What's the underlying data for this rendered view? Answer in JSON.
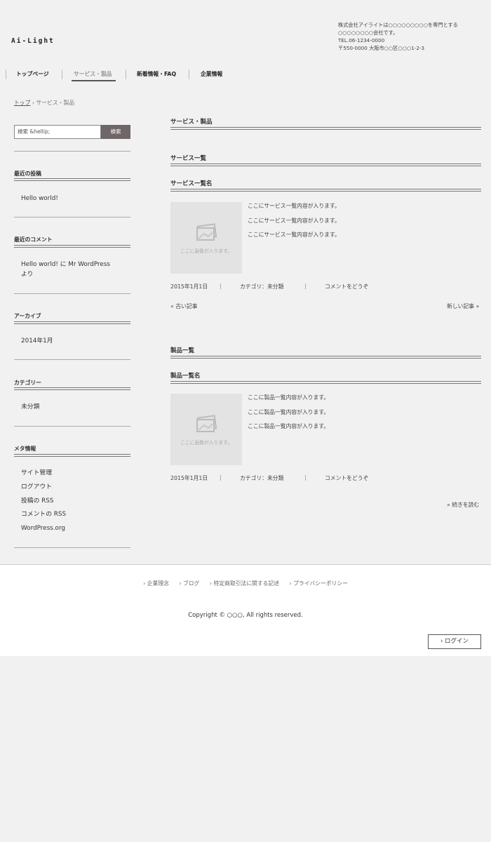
{
  "header": {
    "logo": "Ai-Light",
    "company_lines": [
      "株式会社アイライトは○○○○○○○○○を専門とする",
      "○○○○○○○○会社です。",
      "TEL.06-1234-0000",
      "〒550-0000 大阪市○○区○○○1-2-3"
    ]
  },
  "nav": {
    "items": [
      {
        "label": "トップページ"
      },
      {
        "label": "サービス・製品"
      },
      {
        "label": "新着情報・FAQ"
      },
      {
        "label": "企業情報"
      }
    ]
  },
  "breadcrumb": {
    "home": "トップ",
    "separator": " › ",
    "current": "サービス・製品"
  },
  "sidebar": {
    "search": {
      "placeholder": "検索 &hellip;",
      "button": "検索"
    },
    "recent_posts": {
      "title": "最近の投稿",
      "items": [
        "Hello world!"
      ]
    },
    "recent_comments": {
      "title": "最近のコメント",
      "line1": "Hello world! に Mr WordPress",
      "line2": "より"
    },
    "archives": {
      "title": "アーカイブ",
      "items": [
        "2014年1月"
      ]
    },
    "categories": {
      "title": "カテゴリー",
      "items": [
        "未分類"
      ]
    },
    "meta": {
      "title": "メタ情報",
      "items": [
        "サイト管理",
        "ログアウト",
        "投稿の RSS",
        "コメントの RSS",
        "WordPress.org"
      ]
    }
  },
  "main": {
    "page_title": "サービス・製品",
    "service_section": "サービス一覧",
    "service_post": {
      "title": "サービス一覧名",
      "thumb_text": "ここに画像が入ります。",
      "excerpt": [
        "ここにサービス一覧内容が入ります。",
        "ここにサービス一覧内容が入ります。",
        "ここにサービス一覧内容が入ります。"
      ],
      "date": "2015年1月1日",
      "category": "カテゴリ：未分類",
      "comment": "コメントをどうぞ"
    },
    "pager": {
      "older": "« 古い記事",
      "newer": "新しい記事 »"
    },
    "product_section": "製品一覧",
    "product_post": {
      "title": "製品一覧名",
      "thumb_text": "ここに画像が入ります。",
      "excerpt": [
        "ここに製品一覧内容が入ります。",
        "ここに製品一覧内容が入ります。",
        "ここに製品一覧内容が入ります。"
      ],
      "date": "2015年1月1日",
      "category": "カテゴリ：未分類",
      "comment": "コメントをどうぞ"
    },
    "read_more": "» 続きを読む",
    "meta_separator": "|"
  },
  "footer": {
    "links": [
      "› 企業理念",
      "› ブログ",
      "› 特定商取引法に関する記述",
      "› プライバシーポリシー"
    ],
    "copyright": "Copyright © ○○○, All rights reserved.",
    "login": "› ログイン"
  }
}
